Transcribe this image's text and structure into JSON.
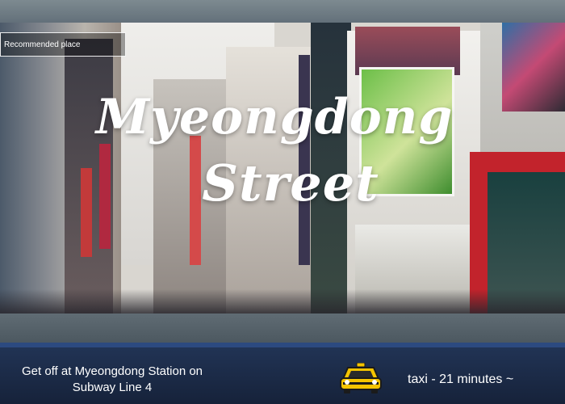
{
  "photo": {
    "tag": "Recommended place",
    "title_line1": "Myeongdong",
    "title_line2": "Street",
    "icon": "street-scene"
  },
  "info": {
    "directions": "Get off at Myeongdong Station on Subway Line 4",
    "taxi_icon": "taxi-icon",
    "taxi_text": "taxi - 21 minutes ~"
  },
  "colors": {
    "bench": "#1c2c4a",
    "taxi_yellow": "#f5c400",
    "text": "#ffffff"
  }
}
